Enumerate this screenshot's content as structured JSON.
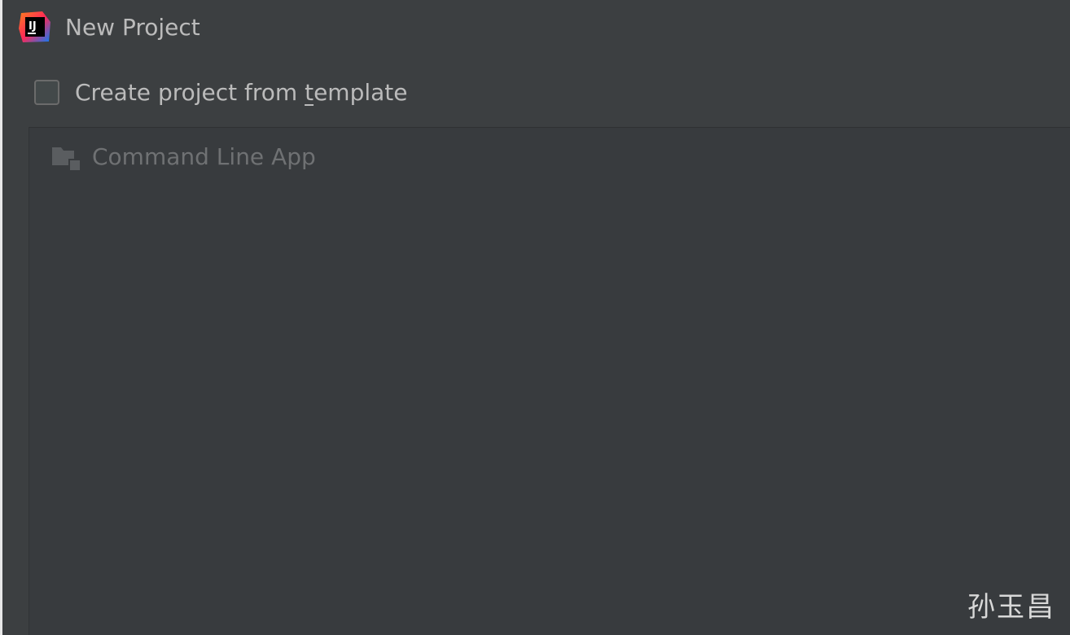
{
  "dialog": {
    "title": "New Project",
    "logo_icon": "intellij-idea-icon"
  },
  "template_option": {
    "label_before": "Create project from ",
    "label_mnemonic": "t",
    "label_after": "emplate",
    "checked": false
  },
  "templates": {
    "items": [
      {
        "label": "Command Line App",
        "icon": "folder-icon",
        "enabled": false
      }
    ]
  },
  "watermark": {
    "text": "孙玉昌"
  },
  "colors": {
    "background": "#3c3f41",
    "list_background": "#383b3e",
    "text": "#bbbbbb",
    "disabled_text": "#6f7173"
  }
}
